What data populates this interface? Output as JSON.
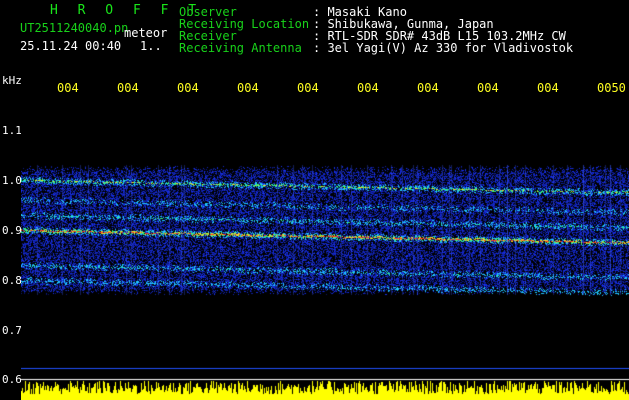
{
  "header": {
    "app_title": "H R O F F T",
    "file_name": "UT2511240040.pn",
    "file_type": "meteor",
    "date_time": "25.11.24 00:40",
    "page_indicator": "1..",
    "observer_label": "Observer",
    "observer_value": ": Masaki Kano",
    "location_label": "Receiving Location",
    "location_value": ": Shibukawa, Gunma, Japan",
    "receiver_label": "Receiver",
    "receiver_value": ": RTL-SDR SDR# 43dB L15 103.2MHz CW",
    "antenna_label": "Receiving Antenna",
    "antenna_value": ": 3el Yagi(V) Az 330 for Vladivostok"
  },
  "axes": {
    "y_unit": "kHz",
    "y_ticks": [
      "1.1",
      "1.0",
      "0.9",
      "0.8",
      "0.7",
      "0.6"
    ],
    "x_ticks": [
      "004",
      "004",
      "004",
      "004",
      "004",
      "004",
      "004",
      "004",
      "004",
      "0050"
    ]
  },
  "colors": {
    "background": "#000000",
    "title_green": "#19e61a",
    "label_green": "#18d21a",
    "text_white": "#ffffff",
    "tick_yellow": "#ffff22",
    "noise_blue": "#1a2cff",
    "signal_cyan": "#20e0ff",
    "signal_red": "#ff2a1a",
    "baseline_yellow": "#ffff00"
  },
  "spectrogram": {
    "y_range_khz": [
      0.6,
      1.1
    ],
    "bands": [
      {
        "freq_khz": 1.0,
        "strength": 0.75
      },
      {
        "freq_khz": 0.9,
        "strength": 1.0
      },
      {
        "freq_khz": 0.93,
        "strength": 0.55
      },
      {
        "freq_khz": 0.83,
        "strength": 0.5
      },
      {
        "freq_khz": 0.8,
        "strength": 0.45
      },
      {
        "freq_khz": 0.96,
        "strength": 0.35
      }
    ]
  }
}
